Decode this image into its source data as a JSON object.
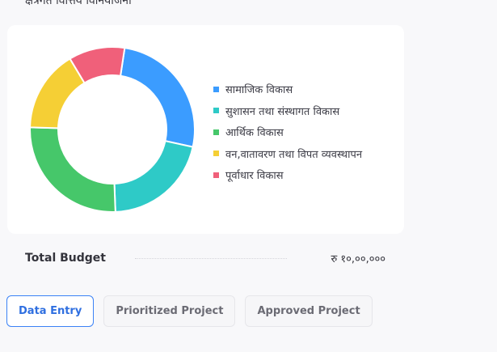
{
  "section": {
    "heading": "क्षेत्रगत वित्तिय विनियोजनो"
  },
  "chart_data": {
    "type": "pie",
    "categories": [
      "सामाजिक विकास",
      "सुशासन तथा संस्थागत विकास",
      "आर्थिक विकास",
      "वन,वातावरण तथा विपत व्यवस्थापन",
      "पूर्वाधार विकास"
    ],
    "values": [
      26,
      21,
      26,
      16,
      11
    ],
    "colors": [
      "#3b9cff",
      "#2ecac7",
      "#46c76a",
      "#f5cf35",
      "#f0607a"
    ],
    "legend_position": "right"
  },
  "budget": {
    "label": "Total Budget",
    "value": "रु १०,००,०००"
  },
  "tabs": [
    {
      "label": "Data Entry",
      "active": true
    },
    {
      "label": "Prioritized Project",
      "active": false
    },
    {
      "label": "Approved Project",
      "active": false
    }
  ]
}
